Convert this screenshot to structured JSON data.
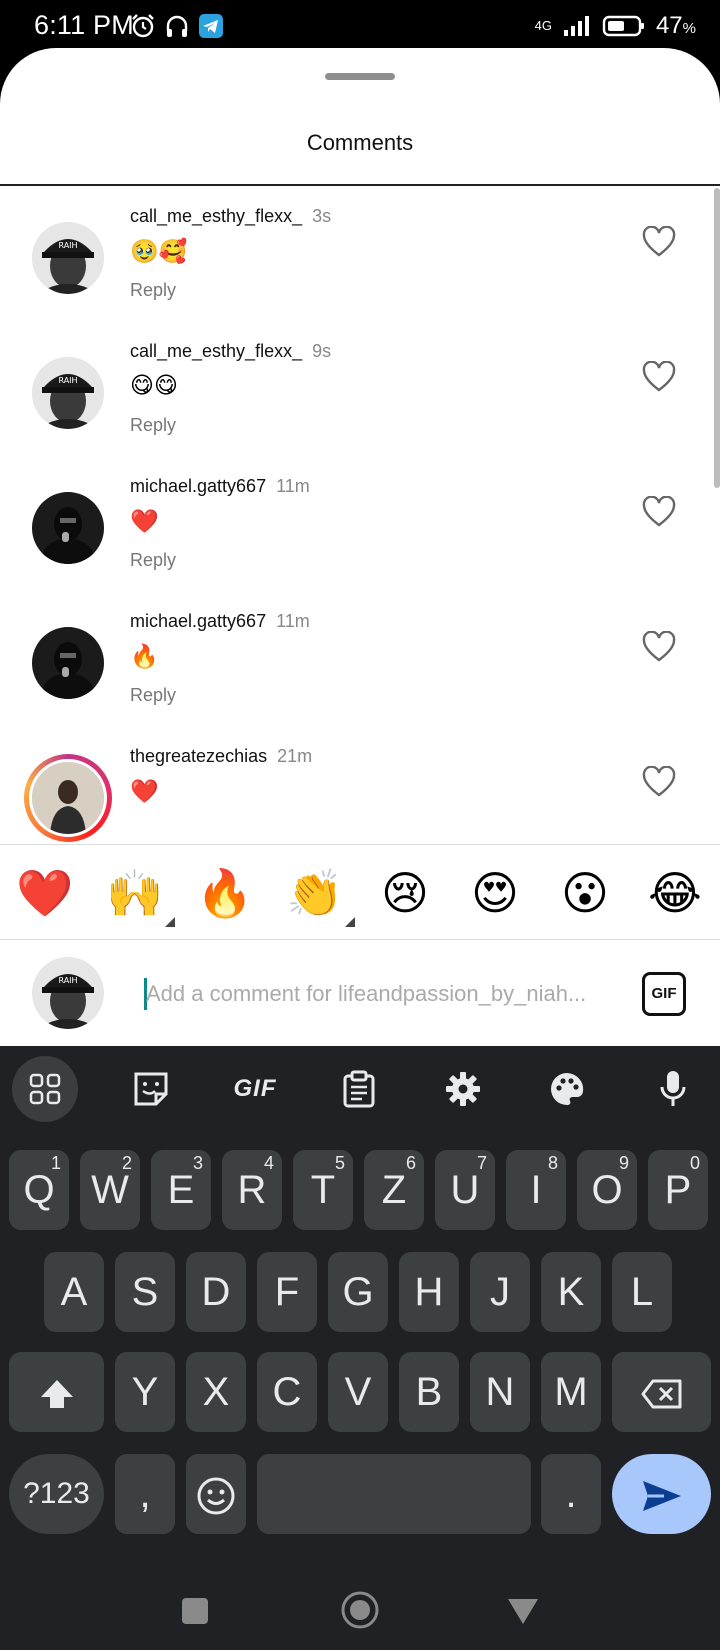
{
  "status_bar": {
    "time": "6:11 PM",
    "network": "4G",
    "battery": "47",
    "battery_unit": "%",
    "icons": [
      "alarm-icon",
      "headphones-icon",
      "telegram-icon",
      "signal-icon",
      "battery-icon"
    ]
  },
  "sheet": {
    "title": "Comments"
  },
  "comments": [
    {
      "username": "call_me_esthy_flexx_",
      "time": "3s",
      "text": "🥹🥰",
      "reply": "Reply",
      "avatar": "avatar-cap"
    },
    {
      "username": "call_me_esthy_flexx_",
      "time": "9s",
      "text": "😋😋",
      "reply": "Reply",
      "avatar": "avatar-cap"
    },
    {
      "username": "michael.gatty667",
      "time": "11m",
      "text": "❤️",
      "reply": "Reply",
      "avatar": "avatar-masked"
    },
    {
      "username": "michael.gatty667",
      "time": "11m",
      "text": "🔥",
      "reply": "Reply",
      "avatar": "avatar-masked"
    },
    {
      "username": "thegreatezechias",
      "time": "21m",
      "text": "❤️",
      "reply": "Reply",
      "avatar": "avatar-story-ring"
    }
  ],
  "reactions": [
    "❤️",
    "🙌",
    "🔥",
    "👏",
    "😢",
    "😍",
    "😮",
    "😂"
  ],
  "comment_input": {
    "placeholder": "Add a comment for lifeandpassion_by_niah...",
    "value": "",
    "gif_label": "GIF"
  },
  "keyboard": {
    "toolbar": [
      "apps-grid-icon",
      "sticker-icon",
      "gif-icon",
      "clipboard-icon",
      "settings-gear-icon",
      "palette-icon",
      "microphone-icon"
    ],
    "toolbar_gif_label": "GIF",
    "row1": [
      {
        "key": "Q",
        "hint": "1"
      },
      {
        "key": "W",
        "hint": "2"
      },
      {
        "key": "E",
        "hint": "3"
      },
      {
        "key": "R",
        "hint": "4"
      },
      {
        "key": "T",
        "hint": "5"
      },
      {
        "key": "Z",
        "hint": "6"
      },
      {
        "key": "U",
        "hint": "7"
      },
      {
        "key": "I",
        "hint": "8"
      },
      {
        "key": "O",
        "hint": "9"
      },
      {
        "key": "P",
        "hint": "0"
      }
    ],
    "row2": [
      "A",
      "S",
      "D",
      "F",
      "G",
      "H",
      "J",
      "K",
      "L"
    ],
    "row3": [
      "Y",
      "X",
      "C",
      "V",
      "B",
      "N",
      "M"
    ],
    "symbols_label": "?123",
    "comma": ",",
    "period": "."
  },
  "colors": {
    "keyboard_bg": "#202124",
    "key_bg": "#3c4043",
    "enter_bg": "#a8c7fa",
    "enter_icon": "#0b3d91"
  }
}
